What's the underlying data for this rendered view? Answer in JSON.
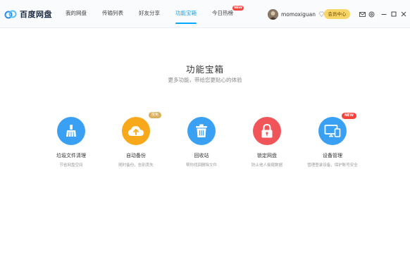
{
  "app": {
    "name": "百度网盘"
  },
  "nav": {
    "items": [
      {
        "label": "我的网盘"
      },
      {
        "label": "传输列表"
      },
      {
        "label": "好友分享"
      },
      {
        "label": "功能宝箱",
        "active": true
      },
      {
        "label": "今日热榜",
        "badge": "NEW"
      }
    ]
  },
  "user": {
    "name": "momoxiguan",
    "vip_label": "会员中心"
  },
  "hero": {
    "title": "功能宝箱",
    "subtitle": "更多功能，带给您更贴心的体验"
  },
  "features": [
    {
      "name": "垃圾文件清理",
      "desc": "节省网盘空间",
      "icon": "broom-icon",
      "color": "#3aa0f3"
    },
    {
      "name": "自动备份",
      "desc": "随时备份，告别丢失",
      "icon": "cloud-upload-icon",
      "color": "#f7a81b",
      "badge": "限免"
    },
    {
      "name": "回收站",
      "desc": "帮你找回删除文件",
      "icon": "trash-icon",
      "color": "#3aa0f3"
    },
    {
      "name": "锁定网盘",
      "desc": "防止他人偷窥数据",
      "icon": "lock-icon",
      "color": "#f0555a"
    },
    {
      "name": "设备管理",
      "desc": "管理登录设备，保护账号安全",
      "icon": "devices-icon",
      "color": "#3aa0f3",
      "badge": "NEW"
    }
  ],
  "colors": {
    "accent": "#06a7ff",
    "vip_bg": "#f8d567",
    "new_badge": "#f4433b"
  }
}
